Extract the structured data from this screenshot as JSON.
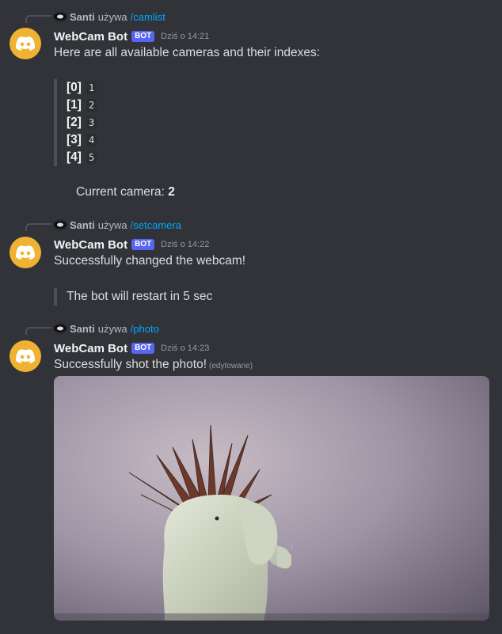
{
  "messages": [
    {
      "reply": {
        "user": "Santi",
        "verb": "używa",
        "command": "/camlist"
      },
      "author": "WebCam Bot",
      "tag": "BOT",
      "time": "Dziś o 14:21",
      "text": "Here are all available cameras and their indexes:",
      "cameras": [
        {
          "index": "[0]",
          "value": "1"
        },
        {
          "index": "[1]",
          "value": "2"
        },
        {
          "index": "[2]",
          "value": "3"
        },
        {
          "index": "[3]",
          "value": "4"
        },
        {
          "index": "[4]",
          "value": "5"
        }
      ],
      "current_label": "Current camera:",
      "current_value": "2"
    },
    {
      "reply": {
        "user": "Santi",
        "verb": "używa",
        "command": "/setcamera"
      },
      "author": "WebCam Bot",
      "tag": "BOT",
      "time": "Dziś o 14:22",
      "text": "Successfully changed the webcam!",
      "quote": "The bot will restart in 5 sec"
    },
    {
      "reply": {
        "user": "Santi",
        "verb": "używa",
        "command": "/photo"
      },
      "author": "WebCam Bot",
      "tag": "BOT",
      "time": "Dziś o 14:23",
      "text": "Successfully shot the photo!",
      "edited": "(edytowane)",
      "attachment": "webcam-photo-elephant-planter"
    }
  ],
  "colors": {
    "background": "#313338",
    "avatar": "#f0b232",
    "bot_tag": "#5865f2",
    "command_link": "#00a8fc"
  },
  "icons": {
    "avatar": "discord-icon",
    "mini_avatar": "user-avatar-icon"
  }
}
